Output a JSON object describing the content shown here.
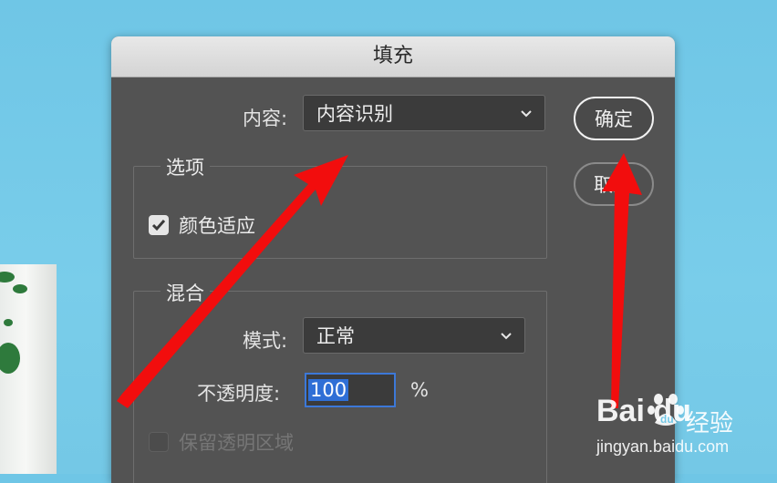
{
  "dialog": {
    "title": "填充",
    "content_label": "内容:",
    "content_value": "内容识别",
    "options_legend": "选项",
    "color_adapt_label": "颜色适应",
    "color_adapt_checked": true,
    "blend_legend": "混合",
    "mode_label": "模式:",
    "mode_value": "正常",
    "opacity_label": "不透明度:",
    "opacity_value": "100",
    "opacity_unit": "%",
    "preserve_label": "保留透明区域",
    "preserve_checked": false,
    "ok_button": "确定",
    "cancel_button": "取",
    "cancel_button_tail": "消"
  },
  "watermark": {
    "logo": "Bai  du",
    "text": "经验",
    "url": "jingyan.baidu.com"
  },
  "colors": {
    "background": "#74c8e6",
    "dialog": "#535353",
    "arrow": "#f20d0d",
    "focus": "#3c78d8"
  }
}
